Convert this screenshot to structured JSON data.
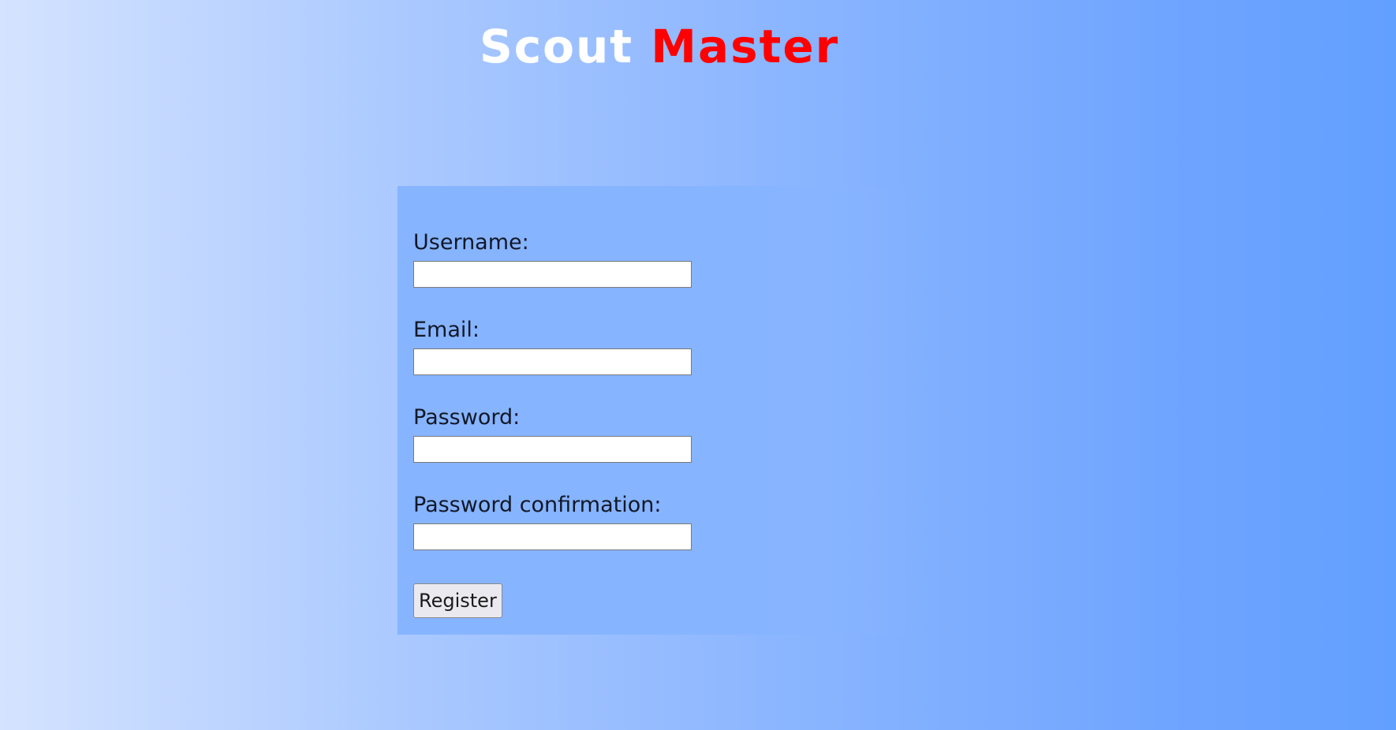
{
  "header": {
    "logo_word_1": "Scout",
    "logo_word_2": "Master",
    "logo_colors": {
      "word_1": "#ffffff",
      "word_2": "#ff0000"
    }
  },
  "form": {
    "fields": [
      {
        "label": "Username:",
        "value": "",
        "type": "text"
      },
      {
        "label": "Email:",
        "value": "",
        "type": "email"
      },
      {
        "label": "Password:",
        "value": "",
        "type": "password"
      },
      {
        "label": "Password confirmation:",
        "value": "",
        "type": "password"
      }
    ],
    "submit_label": "Register"
  },
  "colors": {
    "background_gradient_start": "#d4e3ff",
    "background_gradient_end": "#62a0ff",
    "card_background": "#87b4ff"
  }
}
